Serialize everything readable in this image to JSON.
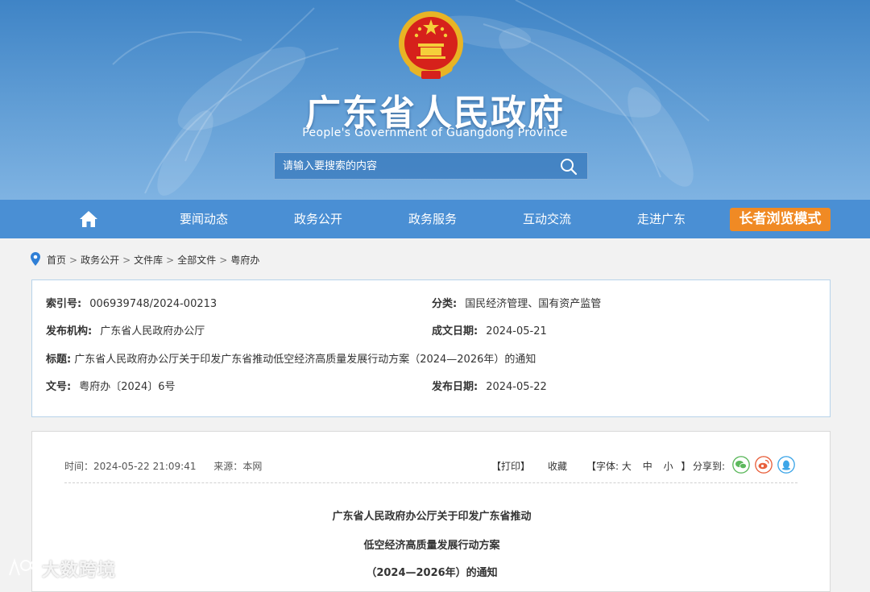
{
  "header": {
    "title": "广东省人民政府",
    "subtitle": "People's Government of Guangdong Province",
    "search_placeholder": "请输入要搜索的内容",
    "emblem": "national-emblem-icon"
  },
  "nav": {
    "home_icon": "home-icon",
    "items": [
      "要闻动态",
      "政务公开",
      "政务服务",
      "互动交流",
      "走进广东"
    ],
    "elder_mode": "长者浏览模式"
  },
  "breadcrumb": {
    "icon": "location-pin-icon",
    "items": [
      "首页",
      "政务公开",
      "文件库",
      "全部文件",
      "粤府办"
    ],
    "separator": ">"
  },
  "meta": {
    "index_label": "索引号:",
    "index_value": "006939748/2024-00213",
    "category_label": "分类:",
    "category_value": "国民经济管理、国有资产监管",
    "issuer_label": "发布机构:",
    "issuer_value": "广东省人民政府办公厅",
    "created_label": "成文日期:",
    "created_value": "2024-05-21",
    "title_label": "标题:",
    "title_value": "广东省人民政府办公厅关于印发广东省推动低空经济高质量发展行动方案（2024—2026年）的通知",
    "docno_label": "文号:",
    "docno_value": "粤府办〔2024〕6号",
    "published_label": "发布日期:",
    "published_value": "2024-05-22"
  },
  "article": {
    "time_label": "时间：",
    "time_value": "2024-05-22 21:09:41",
    "source_label": "来源：",
    "source_value": "本网",
    "print": "【打印】",
    "favorite": "收藏",
    "font_size_label": "【字体:",
    "font_large": "大",
    "font_medium": "中",
    "font_small": "小",
    "font_close": "】",
    "share_label": "分享到:",
    "share_icons": [
      "wechat-icon",
      "weibo-icon",
      "qq-icon"
    ],
    "title_lines": [
      "广东省人民政府办公厅关于印发广东省推动",
      "低空经济高质量发展行动方案",
      "（2024—2026年）的通知"
    ]
  },
  "watermark": {
    "text": "大数跨境"
  },
  "colors": {
    "nav_bg": "#4a8fd4",
    "elder_btn": "#f08a24",
    "meta_border": "#b7d3ea",
    "wechat": "#5cb85c",
    "weibo": "#e8603c",
    "qq": "#3ea6e8"
  }
}
